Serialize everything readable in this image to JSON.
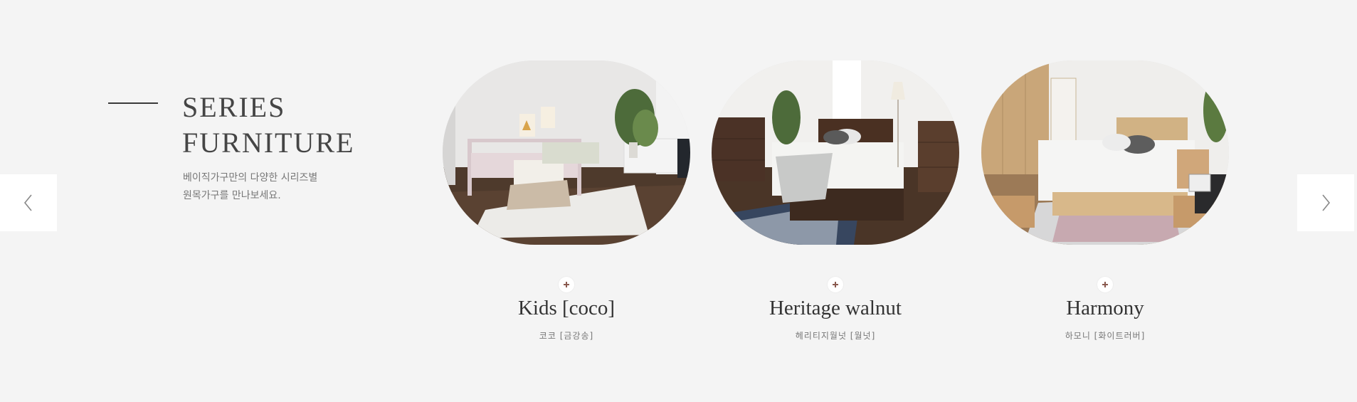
{
  "intro": {
    "title_line1": "SERIES",
    "title_line2": "FURNITURE",
    "desc_line1": "베이직가구만의 다양한 시리즈별",
    "desc_line2": "원목가구를 만나보세요."
  },
  "navigation": {
    "prev_icon": "chevron-left-icon",
    "next_icon": "chevron-right-icon"
  },
  "accent_color": "#8a5a4f",
  "cards": [
    {
      "image": "kids-bedroom-photo",
      "title": "Kids [coco]",
      "subtitle": "코코 [금강송]"
    },
    {
      "image": "walnut-bedroom-photo",
      "title": "Heritage walnut",
      "subtitle": "헤리티지월넛 [월넛]"
    },
    {
      "image": "oak-bedroom-photo",
      "title": "Harmony",
      "subtitle": "하모니 [화이트러버]"
    }
  ]
}
